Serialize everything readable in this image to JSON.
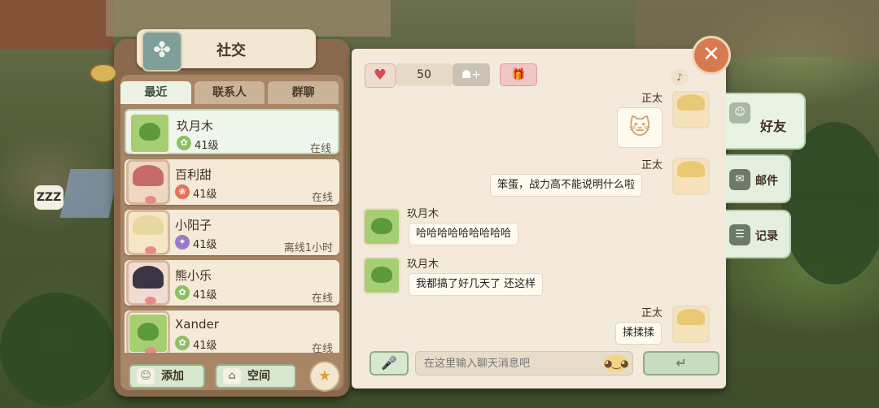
{
  "window": {
    "title": "社交",
    "title_icon": "clover-emblem-icon",
    "zzz": "ZZZ"
  },
  "left_tabs": [
    "最近",
    "联系人",
    "群聊"
  ],
  "friends": [
    {
      "name": "玖月木",
      "level": "41级",
      "status": "在线",
      "level_icon": "✿",
      "avatar": "frog"
    },
    {
      "name": "百利甜",
      "level": "41级",
      "status": "在线",
      "level_icon": "❀",
      "avatar": "girl-red"
    },
    {
      "name": "小阳子",
      "level": "41级",
      "status": "离线1小时",
      "level_icon": "✦",
      "avatar": "girl-blonde"
    },
    {
      "name": "熊小乐",
      "level": "41级",
      "status": "在线",
      "level_icon": "✿",
      "avatar": "girl-dark"
    },
    {
      "name": "Xander",
      "level": "41级",
      "status": "在线",
      "level_icon": "✿",
      "avatar": "frog-cat"
    }
  ],
  "bottom_buttons": {
    "add": "添加",
    "space": "空间"
  },
  "chat": {
    "intimacy": "50",
    "messages": [
      {
        "sender": "正太",
        "type": "sticker",
        "sticker_icon": "cat-face-sticker"
      },
      {
        "sender": "正太",
        "type": "text",
        "text": "笨蛋，战力高不能说明什么啦"
      },
      {
        "sender": "玖月木",
        "type": "text",
        "text": "哈哈哈哈哈哈哈哈哈"
      },
      {
        "sender": "玖月木",
        "type": "text",
        "text": "我都搞了好几天了 还这样"
      },
      {
        "sender": "正太",
        "type": "text",
        "text": "揉揉揉"
      }
    ],
    "input_placeholder": "在这里输入聊天消息吧"
  },
  "side_tabs": [
    {
      "label": "好友",
      "active": true
    },
    {
      "label": "邮件",
      "active": false
    },
    {
      "label": "记录",
      "active": false
    }
  ],
  "colors": {
    "panel_brown": "#8a6a4d",
    "paper": "#f3eadb",
    "accent_green": "#90ad86",
    "close_orange": "#d67a4f"
  }
}
